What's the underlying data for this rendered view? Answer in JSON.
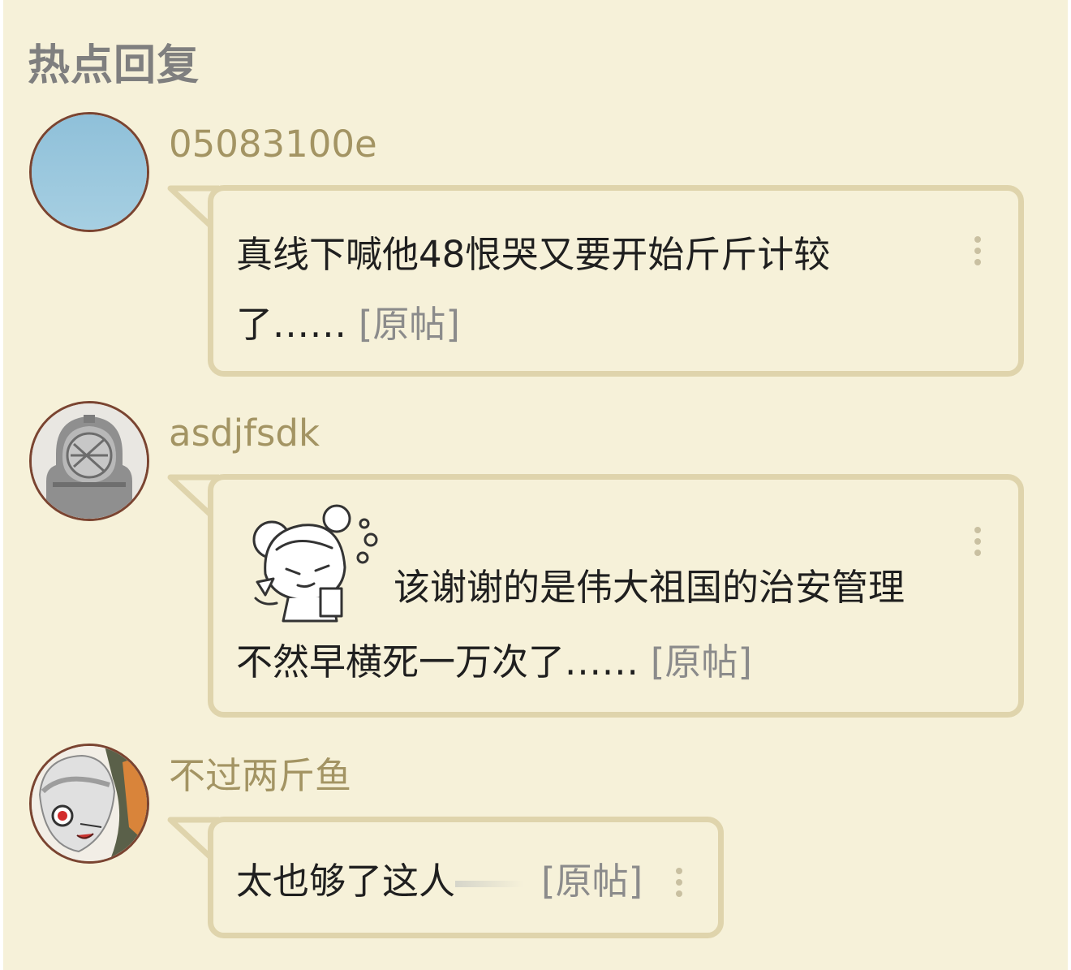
{
  "section_title": "热点回复",
  "replies": [
    {
      "username": "05083100e",
      "text": "真线下喊他48恨哭又要开始斤斤计较",
      "text2": "了",
      "ellipsis": "......",
      "orig_label": "[原帖]"
    },
    {
      "username": "asdjfsdk",
      "text": "该谢谢的是伟大祖国的治安管理",
      "text2": "不然早横死一万次了",
      "ellipsis": "......",
      "orig_label": "[原帖]"
    },
    {
      "username": "不过两斤鱼",
      "text": "太也够了这人",
      "orig_label": "[原帖]"
    }
  ],
  "icons": {
    "more": "vertical-dots-icon",
    "sticker": "anime-girl-sticker"
  },
  "colors": {
    "background": "#f6f1d9",
    "bubble_border": "#dfd4ac",
    "username": "#a39463",
    "title": "#7f7f7f",
    "avatar_border": "#7a4431"
  }
}
